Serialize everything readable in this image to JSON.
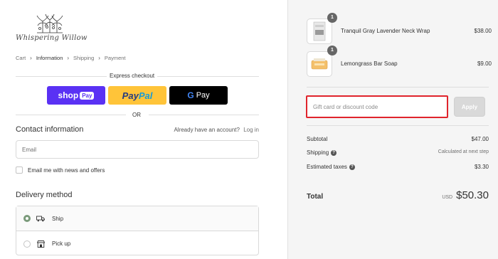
{
  "brand": {
    "name": "Whispering Willow"
  },
  "breadcrumb": [
    {
      "label": "Cart",
      "active": false
    },
    {
      "label": "Information",
      "active": true
    },
    {
      "label": "Shipping",
      "active": false
    },
    {
      "label": "Payment",
      "active": false
    }
  ],
  "express": {
    "label": "Express checkout",
    "shoppay": {
      "shop": "shop",
      "pay": "Pay"
    },
    "paypal": {
      "pay": "Pay",
      "pal": "Pal"
    },
    "gpay": {
      "g": "G",
      "pay": "Pay"
    },
    "or": "OR"
  },
  "contact": {
    "title": "Contact information",
    "account_prompt": "Already have an account?",
    "login_label": "Log in",
    "email_placeholder": "Email",
    "newsletter_label": "Email me with news and offers"
  },
  "delivery": {
    "title": "Delivery method",
    "options": [
      {
        "label": "Ship",
        "selected": true,
        "icon": "truck-icon"
      },
      {
        "label": "Pick up",
        "selected": false,
        "icon": "store-icon"
      }
    ]
  },
  "order": {
    "items": [
      {
        "name": "Tranquil Gray Lavender Neck Wrap",
        "price": "$38.00",
        "quantity": "1"
      },
      {
        "name": "Lemongrass Bar Soap",
        "price": "$9.00",
        "quantity": "1"
      }
    ],
    "discount_placeholder": "Gift card or discount code",
    "apply_label": "Apply",
    "subtotal_label": "Subtotal",
    "subtotal_value": "$47.00",
    "shipping_label": "Shipping",
    "shipping_value": "Calculated at next step",
    "taxes_label": "Estimated taxes",
    "taxes_value": "$3.30",
    "total_label": "Total",
    "currency": "USD",
    "total_value": "$50.30"
  },
  "colors": {
    "shoppay": "#5a31f4",
    "paypal": "#ffc439",
    "gpay": "#000000",
    "highlight": "#e0242c",
    "summary_bg": "#f5f5f5"
  }
}
